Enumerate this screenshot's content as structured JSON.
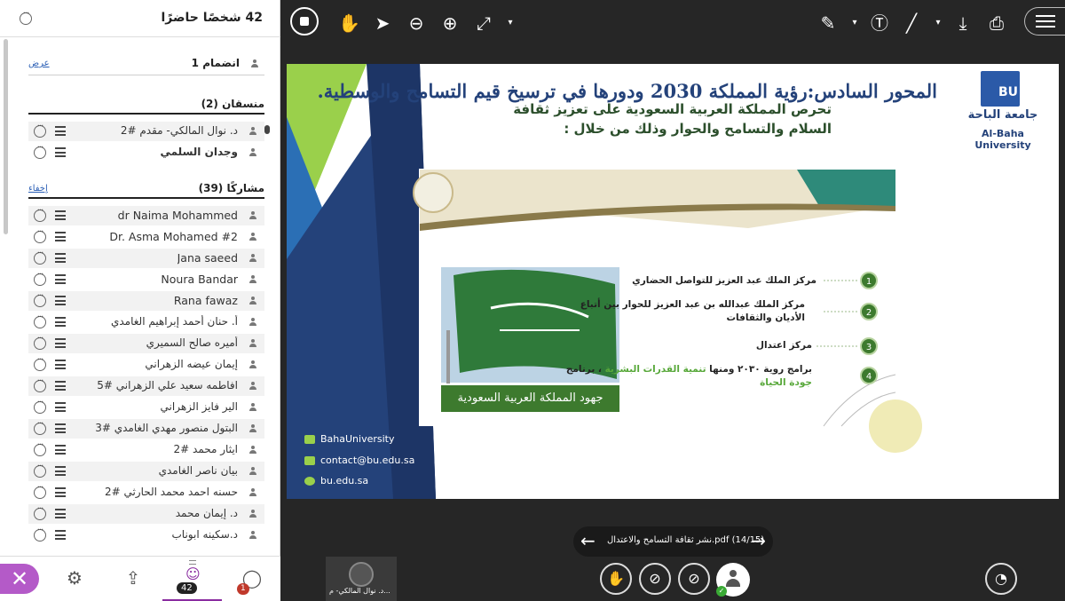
{
  "sidebar": {
    "header_title": "42 شخصًا حاضرًا",
    "joined": {
      "label": "انضمام 1",
      "link": "عرض"
    },
    "moderators": {
      "heading": "منسقان (2)",
      "items": [
        "د. نوال المالكي- مقدم #2",
        "وجدان السلمي"
      ]
    },
    "participants": {
      "heading": "مشاركًا (39)",
      "link": "إخفاء",
      "items": [
        "dr Naima Mohammed",
        "Dr. Asma Mohamed #2",
        "Jana saeed",
        "Noura Bandar",
        "Rana fawaz",
        "أ. حنان أحمد إبراهيم الغامدي",
        "أميره صالح السميري",
        "إيمان عيضه الزهراني",
        "افاطمه سعيد علي الزهراني #5",
        "الير فايز الزهراني",
        "البتول منصور مهدي الغامدي #3",
        "ايثار محمد #2",
        "بيان ناصر الغامدي",
        "حسنه احمد محمد الحارثي #2",
        "د. إيمان محمد",
        "د.سكينه ابوناب"
      ]
    },
    "bottom": {
      "participants_count": "42",
      "chat_badge": "1"
    }
  },
  "toolbar": {
    "icons": [
      "record-icon",
      "hand-icon",
      "pointer-icon",
      "zoom-out-icon",
      "zoom-in-icon",
      "fit-icon",
      "pen-icon",
      "text-icon",
      "line-icon",
      "download-icon",
      "share-icon",
      "menu-icon"
    ]
  },
  "slide": {
    "title": "المحور السادس:رؤية المملكة 2030 ودورها في ترسيخ قيم التسامح والوسطية.",
    "logo_ar": "جامعة الباحة",
    "logo_en": "Al-Baha University",
    "banner_line1": "تحرص المملكة العربية السعودية على تعزيز ثقافة",
    "banner_line2": "السلام والتسامح والحوار وذلك من خلال :",
    "flag_caption": "جهود المملكة العربية السعودية",
    "bullets": [
      {
        "num": "1",
        "text": "مركز الملك عبد العزيز للتواصل الحضاري"
      },
      {
        "num": "2",
        "text": "مركز الملك عبدالله بن عبد العزيز للحوار بين أتباع",
        "text2": "الأديان والثقافات"
      },
      {
        "num": "3",
        "text": "مركز اعتدال"
      },
      {
        "num": "4",
        "text": "برامج روية ٢٠٣٠ ومنها",
        "highlight": "تنمية القدرات البشرية",
        "text_after": "، برنامج",
        "text2": "جودة الحياة"
      }
    ],
    "contacts": [
      "BahaUniversity",
      "contact@bu.edu.sa",
      "bu.edu.sa"
    ],
    "colors": {
      "navy": "#24427a",
      "blue": "#2b5aa8",
      "green": "#3d7a2e",
      "lime": "#9ad04b"
    }
  },
  "pager": {
    "label": "نشر ثقافة التسامح والاعتدال.pdf  (14/15)"
  },
  "video": {
    "name": "د. نوال المالكي- م..."
  }
}
